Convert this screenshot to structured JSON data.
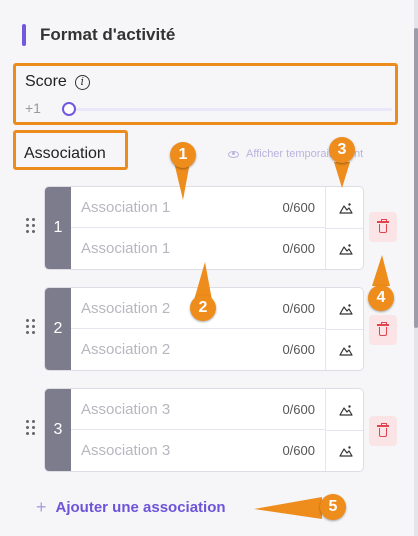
{
  "section": {
    "title": "Format d'activité"
  },
  "score": {
    "label": "Score",
    "value": "+1",
    "level": 0
  },
  "association_label": "Association",
  "temporary_link": "Afficher temporairement",
  "associations": [
    {
      "index": "1",
      "left_placeholder": "Association 1",
      "left_counter": "0/600",
      "right_placeholder": "Association 1",
      "right_counter": "0/600"
    },
    {
      "index": "2",
      "left_placeholder": "Association 2",
      "left_counter": "0/600",
      "right_placeholder": "Association 2",
      "right_counter": "0/600"
    },
    {
      "index": "3",
      "left_placeholder": "Association 3",
      "left_counter": "0/600",
      "right_placeholder": "Association 3",
      "right_counter": "0/600"
    }
  ],
  "add_button": {
    "icon": "plus-icon",
    "label": "Ajouter une association"
  },
  "callouts": [
    "1",
    "2",
    "3",
    "4",
    "5"
  ],
  "colors": {
    "accent": "#7257e0",
    "highlight": "#ec8c1c",
    "danger": "#e2444f",
    "index_bg": "#7d7c8c"
  }
}
